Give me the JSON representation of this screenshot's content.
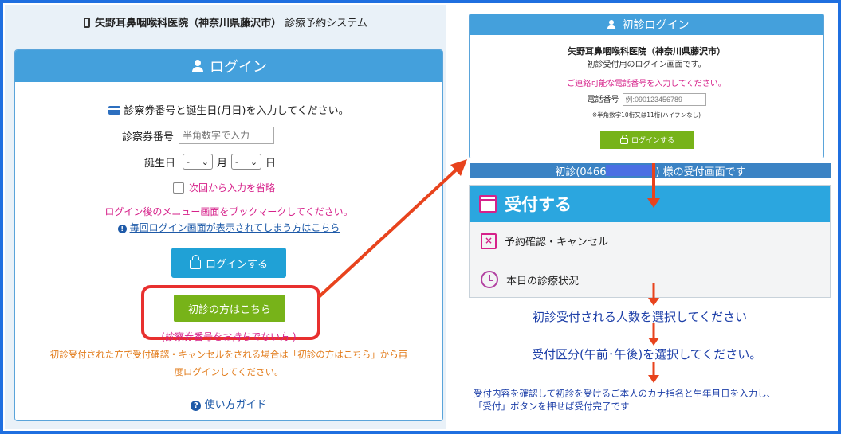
{
  "site_header": {
    "clinic": "矢野耳鼻咽喉科医院（神奈川県藤沢市）",
    "system": "診療予約システム"
  },
  "login": {
    "title": "ログイン",
    "instruction": "診察券番号と誕生日(月日)を入力してください。",
    "card_number_label": "診察券番号",
    "card_number_placeholder": "半角数字で入力",
    "birthday_label": "誕生日",
    "month_select": "-",
    "month_unit": "月",
    "day_select": "-",
    "day_unit": "日",
    "remember_label": "次回から入力を省略",
    "bookmark_notice": "ログイン後のメニュー画面をブックマークしてください。",
    "help_link": "毎回ログイン画面が表示されてしまう方はこちら",
    "login_button": "ログインする",
    "first_visit_button": "初診の方はこちら",
    "first_visit_note": "(診察券番号をお持ちでない方 )",
    "first_visit_guidance_1": "初診受付された方で受付確認・キャンセルをされる場合は「初診の方はこちら」から再",
    "first_visit_guidance_2": "度ログインしてください。",
    "guide_link": "使い方ガイド"
  },
  "first_login": {
    "title": "初診ログイン",
    "clinic": "矢野耳鼻咽喉科医院（神奈川県藤沢市）",
    "subtitle": "初診受付用のログイン画面です。",
    "phone_prompt": "ご連絡可能な電話番号を入力してください。",
    "phone_label": "電話番号",
    "phone_placeholder": "例:090123456789",
    "phone_note": "※半角数字10桁又は11桁(ハイフンなし)",
    "login_button": "ログインする"
  },
  "reception": {
    "bar_prefix": "初診(0466",
    "bar_suffix": ") 様の受付画面です",
    "menu_title": "受付する",
    "item_confirm": "予約確認・キャンセル",
    "item_status": "本日の診療状況"
  },
  "steps": {
    "step1": "初診受付される人数を選択してください",
    "step2": "受付区分(午前･午後)を選択してください。",
    "step3_line1": "受付内容を確認して初診を受けるご本人のカナ指名と生年月日を入力し、",
    "step3_line2": "「受付」ボタンを押せば受付完了です"
  }
}
